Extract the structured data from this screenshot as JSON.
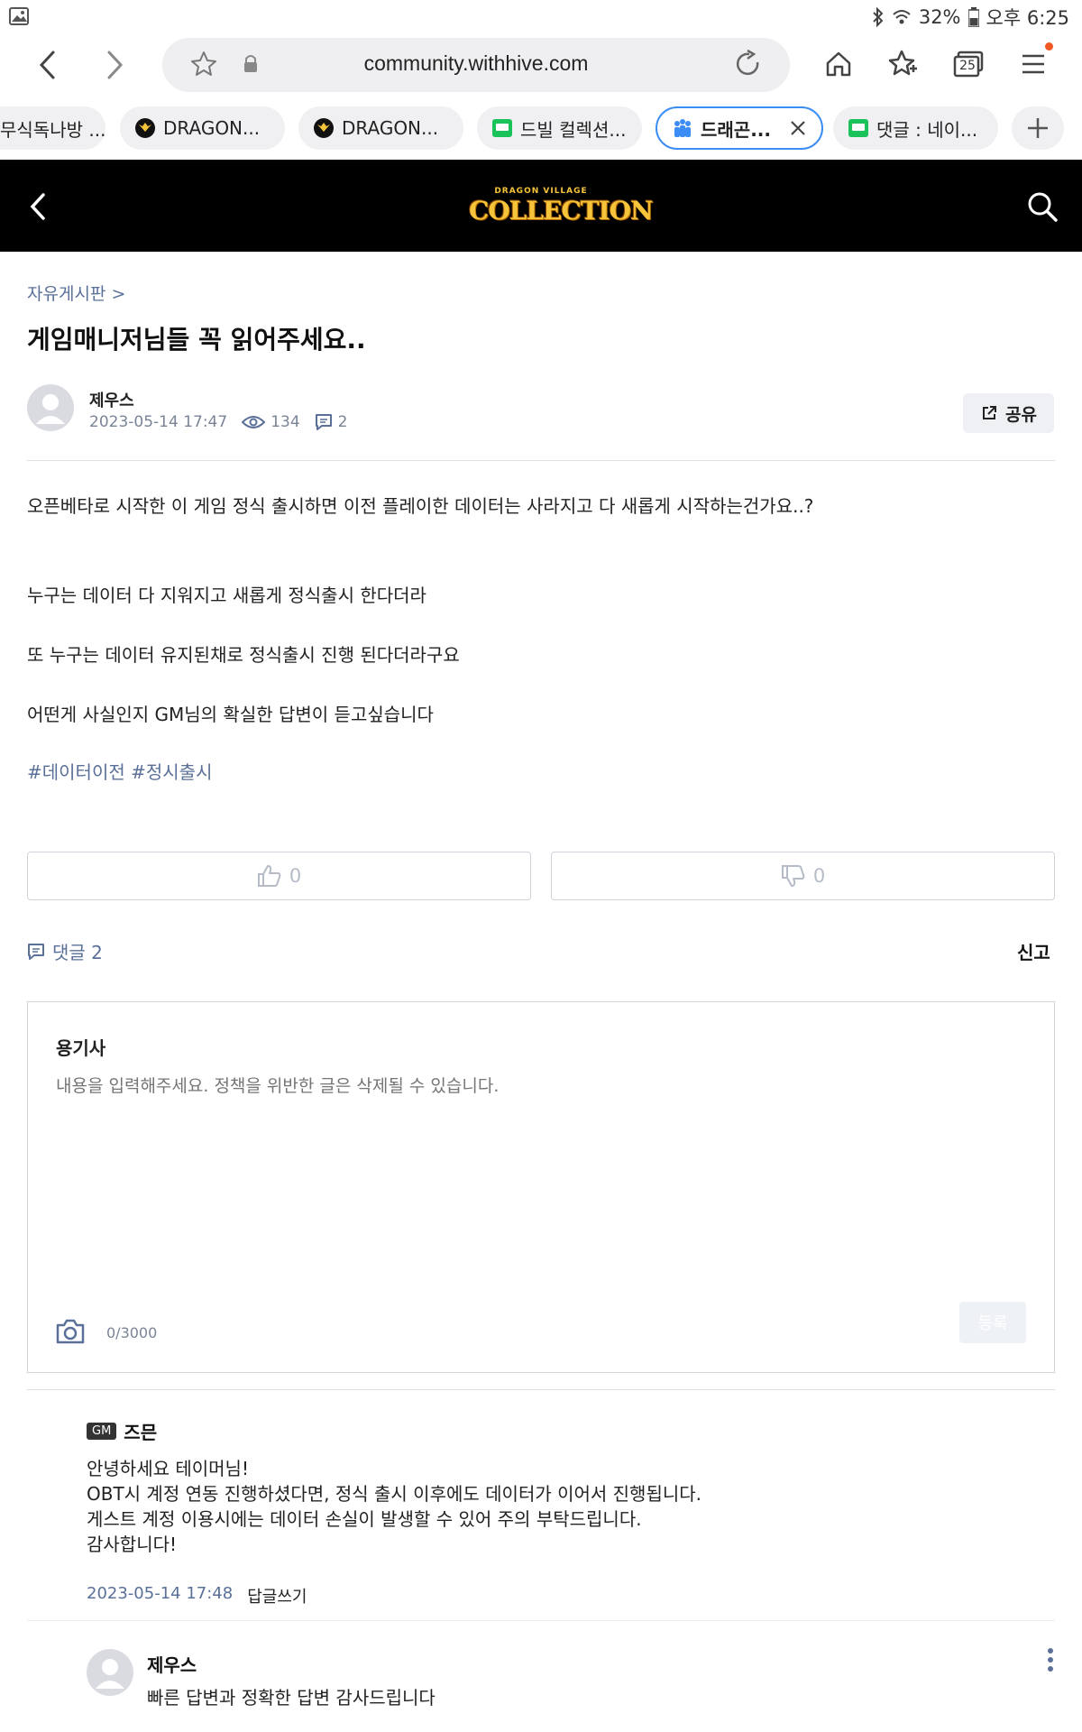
{
  "status_bar": {
    "bluetooth_icon": "bluetooth-icon",
    "wifi_icon": "wifi-icon",
    "battery": "32%",
    "time": "오후 6:25"
  },
  "browser": {
    "url": "community.withhive.com",
    "tab_count": "25",
    "tabs": [
      {
        "label": "무식독나방 ..."
      },
      {
        "label": "DRAGON..."
      },
      {
        "label": "DRAGON..."
      },
      {
        "label": "드빌 컬렉션..."
      },
      {
        "label": "드래곤..."
      },
      {
        "label": "댓글 : 네이..."
      }
    ]
  },
  "site_header": {
    "logo_sub": "DRAGON VILLAGE",
    "logo_main": "COLLECTION"
  },
  "post": {
    "breadcrumb": "자유게시판 >",
    "title": "게임매니저님들 꼭 읽어주세요..",
    "author": "제우스",
    "date": "2023-05-14 17:47",
    "views": "134",
    "comments": "2",
    "share_label": "공유",
    "paragraphs": [
      "오픈베타로 시작한 이 게임 정식 출시하면 이전 플레이한 데이터는 사라지고 다 새롭게 시작하는건가요..?",
      "누구는 데이터 다 지워지고 새롭게 정식출시 한다더라",
      "또 누구는 데이터 유지된채로 정식출시 진행 된다더라구요",
      "어떤게 사실인지 GM님의 확실한 답변이 듣고싶습니다"
    ],
    "hashtags": "#데이터이전 #정시출시",
    "likes": "0",
    "dislikes": "0"
  },
  "comments_section": {
    "label": "댓글 2",
    "report": "신고",
    "composer": {
      "username": "용기사",
      "placeholder": "내용을 입력해주세요. 정책을 위반한 글은 삭제될 수 있습니다.",
      "counter": "0/3000",
      "submit": "등록"
    },
    "items": [
      {
        "badge": "GM",
        "author": "즈믄",
        "lines": [
          "안녕하세요 테이머님!",
          "OBT시 계정 연동 진행하셨다면, 정식 출시 이후에도 데이터가 이어서 진행됩니다.",
          "게스트 계정 이용시에는 데이터 손실이 발생할 수 있어 주의 부탁드립니다.",
          "감사합니다!"
        ],
        "date": "2023-05-14 17:48",
        "reply": "답글쓰기"
      },
      {
        "author": "제우스",
        "text": "빠른 답변과 정확한 답변 감사드립니다"
      }
    ]
  },
  "colors": {
    "accent_blue": "#3b8df5",
    "meta_gray": "#7a8497",
    "header_black": "#000000",
    "logo_gold": "#f5c43a"
  }
}
